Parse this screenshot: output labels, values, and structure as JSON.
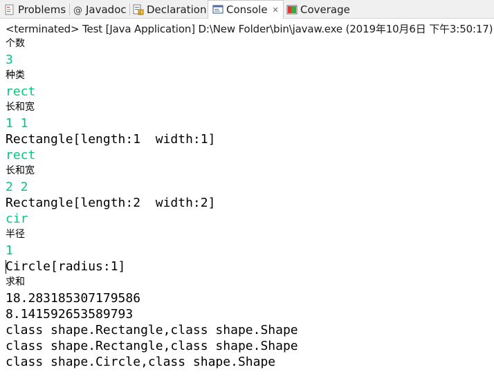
{
  "tabs": [
    {
      "label": "Problems",
      "icon": "problems-icon"
    },
    {
      "label": "Javadoc",
      "icon": "javadoc-icon"
    },
    {
      "label": "Declaration",
      "icon": "declaration-icon"
    },
    {
      "label": "Console",
      "icon": "console-icon",
      "active": true,
      "close_glyph": "✕"
    },
    {
      "label": "Coverage",
      "icon": "coverage-icon"
    }
  ],
  "status": "<terminated> Test [Java Application] D:\\New Folder\\bin\\javaw.exe (2019年10月6日 下午3:50:17)",
  "input_color": "#00c87d",
  "console_lines": [
    {
      "text": "个数",
      "kind": "cjk"
    },
    {
      "text": "3",
      "kind": "in"
    },
    {
      "text": "种类",
      "kind": "cjk"
    },
    {
      "text": "rect",
      "kind": "in"
    },
    {
      "text": "长和宽",
      "kind": "cjk"
    },
    {
      "text": "1 1",
      "kind": "in"
    },
    {
      "text": "Rectangle[length:1  width:1]",
      "kind": "out"
    },
    {
      "text": "rect",
      "kind": "in"
    },
    {
      "text": "长和宽",
      "kind": "cjk"
    },
    {
      "text": "2 2",
      "kind": "in"
    },
    {
      "text": "Rectangle[length:2  width:2]",
      "kind": "out"
    },
    {
      "text": "cir",
      "kind": "in"
    },
    {
      "text": "半径",
      "kind": "cjk"
    },
    {
      "text": "1",
      "kind": "in"
    },
    {
      "text": "Circle[radius:1]",
      "kind": "out"
    },
    {
      "text": "求和",
      "kind": "cjk"
    },
    {
      "text": "18.283185307179586",
      "kind": "out"
    },
    {
      "text": "8.141592653589793",
      "kind": "out"
    },
    {
      "text": "class shape.Rectangle,class shape.Shape",
      "kind": "out"
    },
    {
      "text": "class shape.Rectangle,class shape.Shape",
      "kind": "out"
    },
    {
      "text": "class shape.Circle,class shape.Shape",
      "kind": "out"
    }
  ]
}
